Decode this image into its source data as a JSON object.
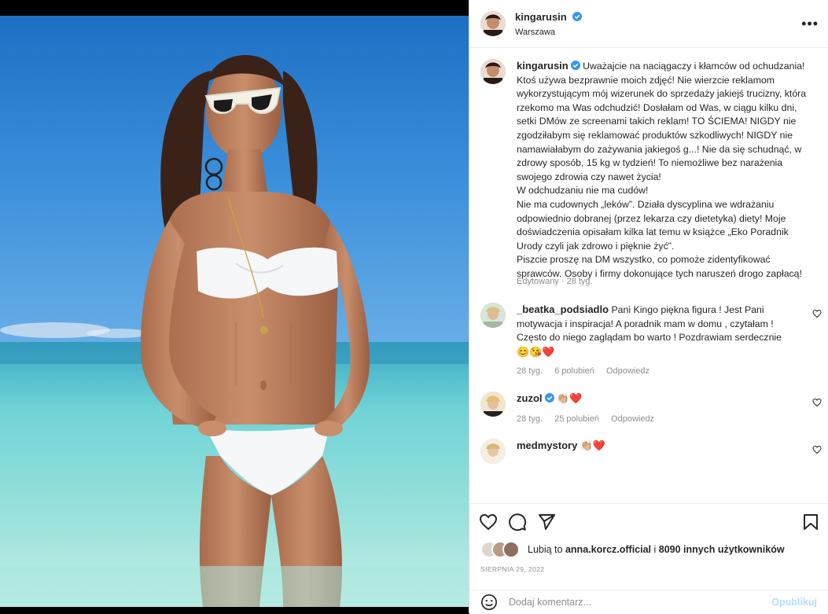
{
  "post": {
    "username": "kingarusin",
    "location": "Warszawa",
    "more_icon": "•••"
  },
  "caption": {
    "username": "kingarusin",
    "paragraphs": [
      "Uważajcie na naciągaczy i kłamców od ochudzania! Ktoś używa bezprawnie moich zdjęć! Nie wierzcie reklamom wykorzystującym mój wizerunek do sprzedaży jakiejś trucizny, która rzekomo ma Was odchudzić! Dosłałam od Was, w ciągu kilku dni, setki DMów ze screenami takich reklam! TO ŚCIEMA! NIGDY nie zgodziłabym się reklamować produktów szkodliwych! NIGDY nie namawiałabym do zażywania jakiegoś g...! Nie da się schudnąć, w zdrowy sposób, 15 kg w tydzień! To niemożliwe bez narażenia swojego zdrowia czy nawet życia!",
      "W odchudzaniu nie ma cudów!\nNie ma cudownych „leków”. Działa dyscyplina we wdrażaniu odpowiednio dobranej (przez lekarza czy dietetyka) diety! Moje doświadczenia opisałam kilka lat temu w książce „Eko Poradnik Urody czyli jak zdrowo i pięknie żyć”.",
      "Piszcie proszę na DM wszystko, co pomoże zidentyfikować sprawców. Osoby i firmy dokonujące tych naruszeń drogo zapłacą!"
    ],
    "meta": "Edytowany · 28 tyg."
  },
  "comments": [
    {
      "username": "_beatka_podsiadlo",
      "text": "Pani Kingo piękna figura ! Jest Pani motywacja i inspiracja! A poradnik mam w domu , czytałam ! Często do niego zaglądam bo warto ! Pozdrawiam serdecznie",
      "emoji": "😊😘❤️",
      "time": "28 tyg.",
      "likes": "6 polubień",
      "reply": "Odpowiedz"
    },
    {
      "username": "zuzol",
      "text": "",
      "emoji": "👏🏼❤️",
      "time": "28 tyg.",
      "likes": "25 polubień",
      "reply": "Odpowiedz"
    },
    {
      "username": "medmystory",
      "text": "",
      "emoji": "👏🏼❤️",
      "time": "",
      "likes": "",
      "reply": ""
    }
  ],
  "likes": {
    "prefix": "Lubią to",
    "user": "anna.korcz.official",
    "middle": "i",
    "others": "8090 innych użytkowników"
  },
  "date": "SIERPNIA 29, 2022",
  "add_comment": {
    "placeholder": "Dodaj komentarz...",
    "publish": "Opublikuj"
  },
  "colors": {
    "verified": "#3897f0",
    "link": "#0095f6",
    "muted": "#8e8e8e"
  }
}
